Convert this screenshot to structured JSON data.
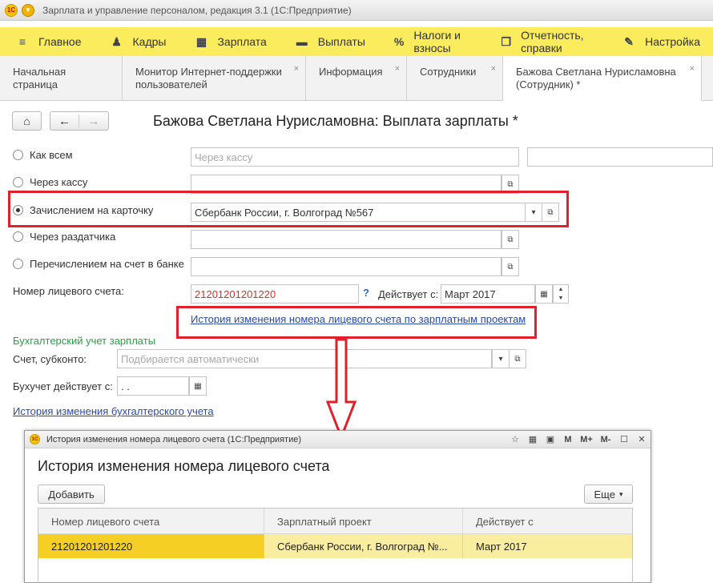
{
  "window": {
    "logo_text": "1С",
    "title": "Зарплата и управление персоналом, редакция 3.1 (1С:Предприятие)"
  },
  "main_menu": [
    {
      "icon": "≡",
      "icon_name": "hamburger-icon",
      "label": "Главное"
    },
    {
      "icon": "♟",
      "icon_name": "people-icon",
      "label": "Кадры"
    },
    {
      "icon": "▦",
      "icon_name": "calculator-icon",
      "label": "Зарплата"
    },
    {
      "icon": "▬",
      "icon_name": "wallet-icon",
      "label": "Выплаты"
    },
    {
      "icon": "%",
      "icon_name": "percent-icon",
      "label": "Налоги и взносы"
    },
    {
      "icon": "❐",
      "icon_name": "reports-icon",
      "label": "Отчетность, справки"
    },
    {
      "icon": "✎",
      "icon_name": "wrench-icon",
      "label": "Настройка"
    }
  ],
  "tabs": [
    {
      "label": "Начальная страница",
      "closable": false
    },
    {
      "label": "Монитор Интернет-поддержки пользователей",
      "closable": true
    },
    {
      "label": "Информация",
      "closable": true
    },
    {
      "label": "Сотрудники",
      "closable": true
    },
    {
      "label": "Бажова Светлана Нурисламовна (Сотрудник) *",
      "closable": true
    }
  ],
  "form": {
    "title": "Бажова Светлана Нурисламовна: Выплата зарплаты *",
    "radios": [
      {
        "label": "Как всем",
        "checked": false,
        "field_value": "",
        "field_placeholder": "Через кассу"
      },
      {
        "label": "Через кассу",
        "checked": false,
        "field_value": ""
      },
      {
        "label": "Зачислением на карточку",
        "checked": true,
        "field_value": "Сбербанк России, г. Волгоград №567"
      },
      {
        "label": "Через раздатчика",
        "checked": false,
        "field_value": ""
      },
      {
        "label": "Перечислением на счет в банке",
        "checked": false,
        "field_value": ""
      }
    ],
    "account_label": "Номер лицевого счета:",
    "account_value": "21201201201220",
    "help_mark": "?",
    "valid_from_label": "Действует с:",
    "valid_from_value": "Март 2017",
    "account_history_link": "История изменения номера лицевого счета по зарплатным проектам",
    "accounting_section": "Бухгалтерский учет зарплаты",
    "subconto_label": "Счет, субконто:",
    "subconto_placeholder": "Подбирается автоматически",
    "accounting_from_label": "Бухучет действует с:",
    "accounting_from_value": " .  .",
    "accounting_history_link": "История изменения бухгалтерского учета"
  },
  "dialog": {
    "title": "История изменения номера лицевого счета  (1С:Предприятие)",
    "toolbar": [
      "M",
      "M+",
      "M-"
    ],
    "heading": "История изменения номера лицевого счета",
    "add_button": "Добавить",
    "more_button": "Еще",
    "columns": [
      "Номер лицевого счета",
      "Зарплатный проект",
      "Действует с"
    ],
    "rows": [
      [
        "21201201201220",
        "Сбербанк России, г. Волгоград №...",
        "Март 2017"
      ]
    ]
  },
  "colors": {
    "menu_bg": "#fbec5d",
    "highlight_red": "#e0202a",
    "link_blue": "#2b4ba0",
    "section_green": "#2e9b47",
    "row_highlight": "#f9eea0",
    "cell_selected": "#f5cf24"
  }
}
